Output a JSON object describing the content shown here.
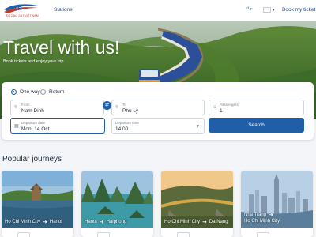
{
  "header": {
    "logo_text": "VR",
    "logo_subtext": "ĐƯỜNG SẮT VIỆT NAM",
    "nav_stations": "Stations",
    "currency_symbol": "₫",
    "book_ticket": "Book my ticket"
  },
  "hero": {
    "title": "Travel with us!",
    "subtitle": "Book tickets and enjoy your trip"
  },
  "search": {
    "trip_one_way": "One way",
    "trip_return": "Return",
    "from_label": "From",
    "from_value": "Nam Dinh",
    "to_label": "To",
    "to_value": "Phu Ly",
    "passengers_label": "Passengers",
    "passengers_value": "1",
    "departure_date_label": "Departure date",
    "departure_date_value": "Mon, 14 Oct",
    "departure_time_label": "Departure time",
    "departure_time_value": "14:00",
    "search_button": "Search"
  },
  "popular": {
    "title": "Popular journeys",
    "journeys": [
      {
        "from": "Ho Chi Minh City",
        "to": "Hanoi"
      },
      {
        "from": "Hanoi",
        "to": "Haiphong"
      },
      {
        "from": "Ho Chi Minh City",
        "to": "Da Nang"
      },
      {
        "from": "Nha Trang",
        "to": "Ho Chi Minh City"
      }
    ]
  },
  "colors": {
    "primary": "#1e5fa8",
    "logo_red": "#c0392b",
    "text_dark": "#1d2a3a"
  }
}
